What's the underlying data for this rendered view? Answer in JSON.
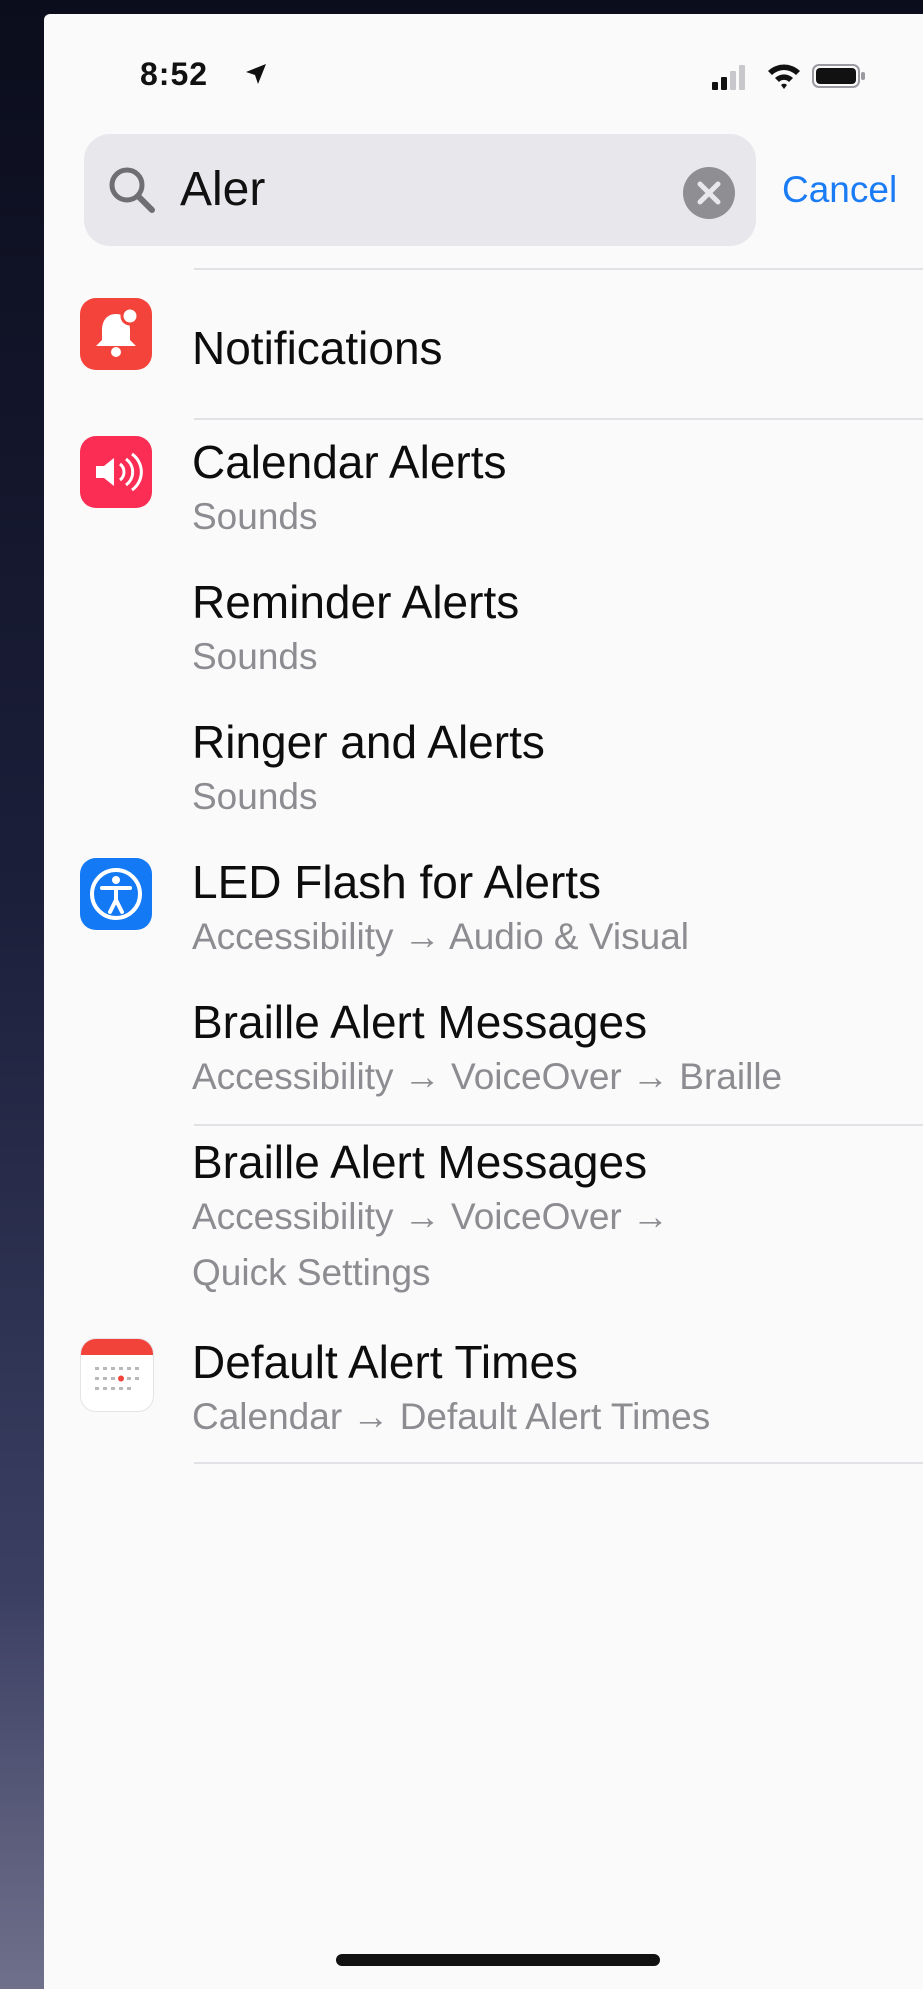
{
  "status_bar": {
    "time": "8:52",
    "icons": [
      "location-arrow-icon",
      "cellular-signal-icon",
      "wifi-icon",
      "battery-icon"
    ]
  },
  "search": {
    "value": "Aler",
    "cancel_label": "Cancel",
    "icons": [
      "search-icon",
      "clear-icon"
    ]
  },
  "results": [
    {
      "title": "Notifications",
      "subtitle": "",
      "icon": "notifications-icon",
      "icon_color": "#f4433a"
    },
    {
      "title": "Calendar Alerts",
      "subtitle": "Sounds",
      "icon": "sounds-icon",
      "icon_color": "#fb2d55"
    },
    {
      "title": "Reminder Alerts",
      "subtitle": "Sounds",
      "icon": "",
      "icon_color": ""
    },
    {
      "title": "Ringer and Alerts",
      "subtitle": "Sounds",
      "icon": "",
      "icon_color": ""
    },
    {
      "title": "LED Flash for Alerts",
      "subtitle": "Accessibility → Audio & Visual",
      "icon": "accessibility-icon",
      "icon_color": "#1479f4"
    },
    {
      "title": "Braille Alert Messages",
      "subtitle": "Accessibility → VoiceOver → Braille",
      "icon": "",
      "icon_color": ""
    },
    {
      "title": "Braille Alert Messages",
      "subtitle": "Accessibility → VoiceOver →",
      "subtitle2": "Quick Settings",
      "icon": "",
      "icon_color": ""
    },
    {
      "title": "Default Alert Times",
      "subtitle": "Calendar → Default Alert Times",
      "icon": "calendar-icon",
      "icon_color": "#ffffff"
    }
  ],
  "colors": {
    "accent": "#1a7cf5",
    "title_text": "#0d0d0d",
    "subtitle_text": "#8c8c91",
    "search_bg": "#e8e8ec"
  }
}
